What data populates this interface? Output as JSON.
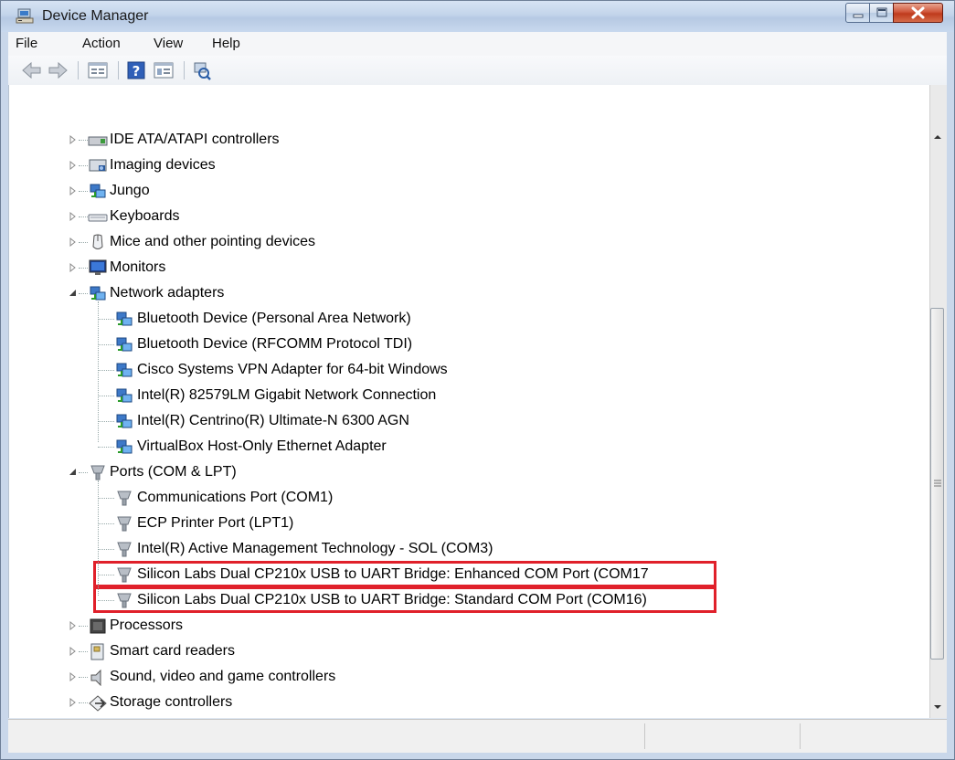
{
  "window": {
    "title": "Device Manager",
    "controls": {
      "minimize": "minimize",
      "maximize": "maximize",
      "close": "close"
    }
  },
  "menu": [
    "File",
    "Action",
    "View",
    "Help"
  ],
  "toolbar": {
    "buttons": [
      "back-icon",
      "forward-icon",
      "properties-grid-icon",
      "help-icon",
      "view-grid-icon",
      "scan-hardware-icon"
    ]
  },
  "tree": {
    "categories": [
      {
        "label": "IDE ATA/ATAPI controllers",
        "icon": "ide-controller-icon",
        "expanded": false
      },
      {
        "label": "Imaging devices",
        "icon": "imaging-icon",
        "expanded": false
      },
      {
        "label": "Jungo",
        "icon": "network-icon",
        "expanded": false
      },
      {
        "label": "Keyboards",
        "icon": "keyboard-icon",
        "expanded": false
      },
      {
        "label": "Mice and other pointing devices",
        "icon": "mouse-icon",
        "expanded": false
      },
      {
        "label": "Monitors",
        "icon": "monitor-icon",
        "expanded": false
      },
      {
        "label": "Network adapters",
        "icon": "network-icon",
        "expanded": true,
        "children": [
          "Bluetooth Device (Personal Area Network)",
          "Bluetooth Device (RFCOMM Protocol TDI)",
          "Cisco Systems VPN Adapter for 64-bit Windows",
          "Intel(R) 82579LM Gigabit Network Connection",
          "Intel(R) Centrino(R) Ultimate-N 6300 AGN",
          "VirtualBox Host-Only Ethernet Adapter"
        ]
      },
      {
        "label": "Ports (COM & LPT)",
        "icon": "port-icon",
        "expanded": true,
        "children": [
          "Communications Port (COM1)",
          "ECP Printer Port (LPT1)",
          "Intel(R) Active Management Technology - SOL (COM3)",
          "Silicon Labs Dual CP210x USB to UART Bridge: Enhanced COM Port (COM17",
          "Silicon Labs Dual CP210x USB to UART Bridge: Standard COM Port (COM16)"
        ],
        "highlighted_children": [
          3,
          4
        ]
      },
      {
        "label": "Processors",
        "icon": "processor-icon",
        "expanded": false
      },
      {
        "label": "Smart card readers",
        "icon": "smartcard-icon",
        "expanded": false
      },
      {
        "label": "Sound, video and game controllers",
        "icon": "sound-icon",
        "expanded": false
      },
      {
        "label": "Storage controllers",
        "icon": "storage-icon",
        "expanded": false
      }
    ]
  },
  "colors": {
    "highlight_box": "#e0202a",
    "title_gradient": "#c3d4ea",
    "close_button": "#c8452a"
  }
}
